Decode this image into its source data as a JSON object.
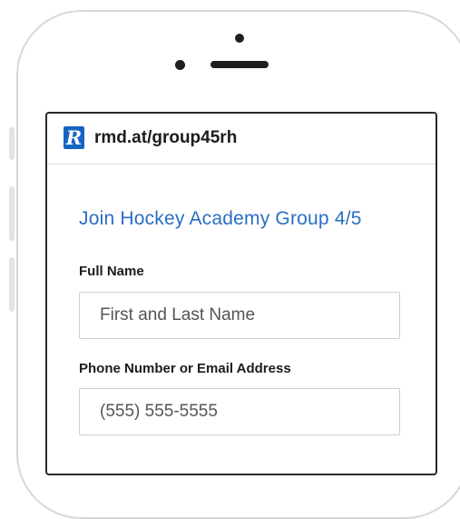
{
  "browser": {
    "url": "rmd.at/group45rh",
    "logo_glyph": "R",
    "logo_color": "#1565c0"
  },
  "form": {
    "title": "Join Hockey Academy Group 4/5",
    "title_color": "#2a6fc1",
    "fields": [
      {
        "label": "Full Name",
        "placeholder": "First and Last Name",
        "value": ""
      },
      {
        "label": "Phone Number or Email Address",
        "placeholder": "(555) 555-5555",
        "value": ""
      }
    ]
  }
}
